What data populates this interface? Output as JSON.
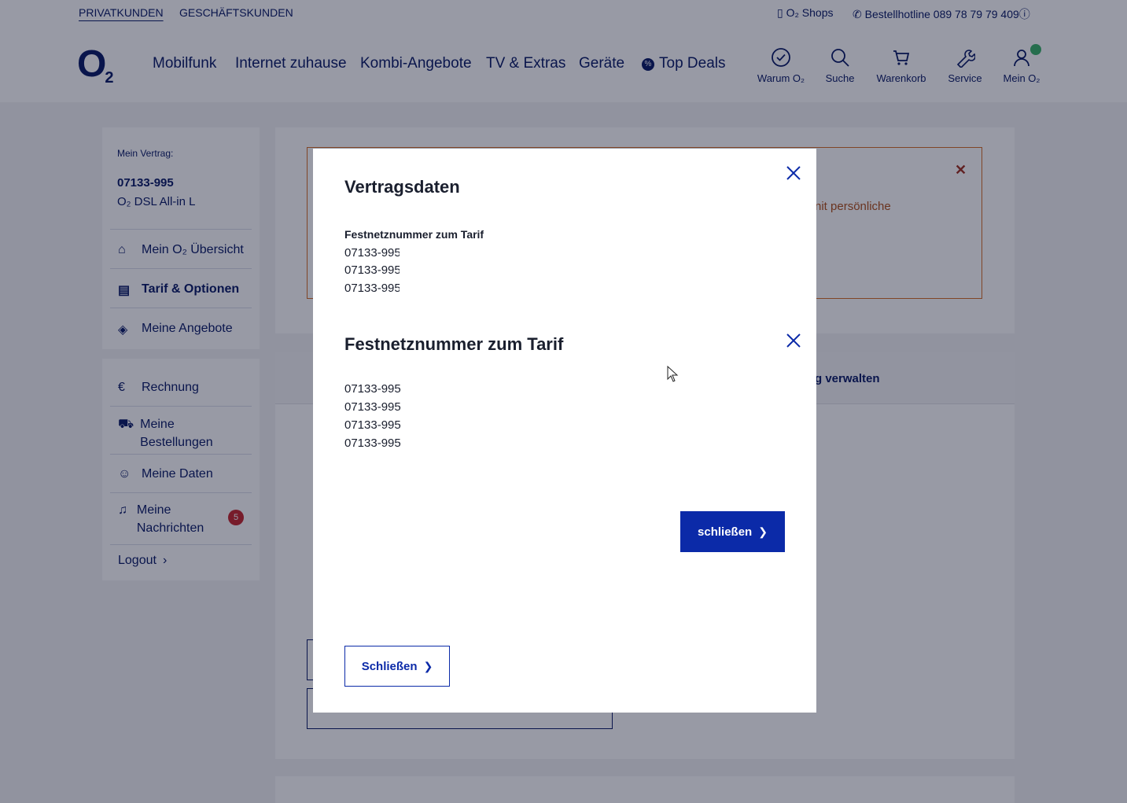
{
  "topbar": {
    "private_label": "PRIVATKUNDEN",
    "business_label": "GESCHÄFTSKUNDEN",
    "shops_label": "O₂ Shops",
    "hotline_label": "Bestellhotline 089 78 79 79 409"
  },
  "header": {
    "logo": "O",
    "logo_sub": "2",
    "nav": [
      "Mobilfunk",
      "Internet zuhause",
      "Kombi-Angebote",
      "TV & Extras",
      "Geräte",
      "Top Deals"
    ],
    "icons": {
      "why": "Warum O₂",
      "search": "Suche",
      "cart": "Warenkorb",
      "service": "Service",
      "account": "Mein O₂"
    }
  },
  "sidebar": {
    "contract_label": "Mein Vertrag:",
    "contract_number": "07133-995",
    "contract_tariff": "O₂ DSL All-in L",
    "items": [
      "Mein O₂ Übersicht",
      "Tarif & Optionen",
      "Meine Angebote"
    ],
    "items2": [
      "Rechnung",
      "Meine Bestellungen",
      "Meine Daten",
      "Meine Nachrichten"
    ],
    "messages_count": "5",
    "logout": "Logout"
  },
  "background": {
    "alert_text": "nit persönliche",
    "manage_link": "g verwalten"
  },
  "modal": {
    "title": "Vertragsdaten",
    "sub_heading": "Festnetznummer zum Tarif",
    "numbers_top": [
      "07133-995",
      "07133-995",
      "07133-995"
    ],
    "inner_title": "Festnetznummer zum Tarif",
    "numbers_inner": [
      "07133-995",
      "07133-995",
      "07133-995",
      "07133-995"
    ],
    "primary_button": "schließen",
    "outline_button": "Schließen"
  },
  "colors": {
    "brand": "#0a1a66",
    "button": "#0b2aa8",
    "alert_border": "#d66d27",
    "badge": "#c6262e"
  }
}
